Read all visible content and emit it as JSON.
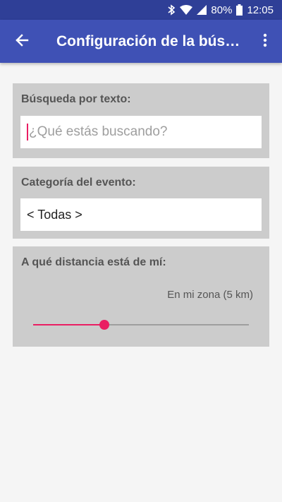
{
  "status_bar": {
    "battery_text": "80%",
    "time": "12:05",
    "icons": [
      "bluetooth-icon",
      "wifi-icon",
      "cell-signal-icon",
      "battery-icon"
    ]
  },
  "app_bar": {
    "title": "Configuración de la búsqueda",
    "icons": [
      "back-arrow-icon",
      "more-vert-icon"
    ],
    "color": "#3f51b5"
  },
  "search_text": {
    "label": "Búsqueda por texto:",
    "value": "",
    "placeholder": "¿Qué estás buscando?"
  },
  "category": {
    "label": "Categoría del evento:",
    "selected": "< Todas >"
  },
  "distance": {
    "label": "A qué distancia está de mí:",
    "value_text": "En mi zona (5 km)",
    "slider_fraction": 0.33,
    "accent_color": "#e91e63"
  }
}
